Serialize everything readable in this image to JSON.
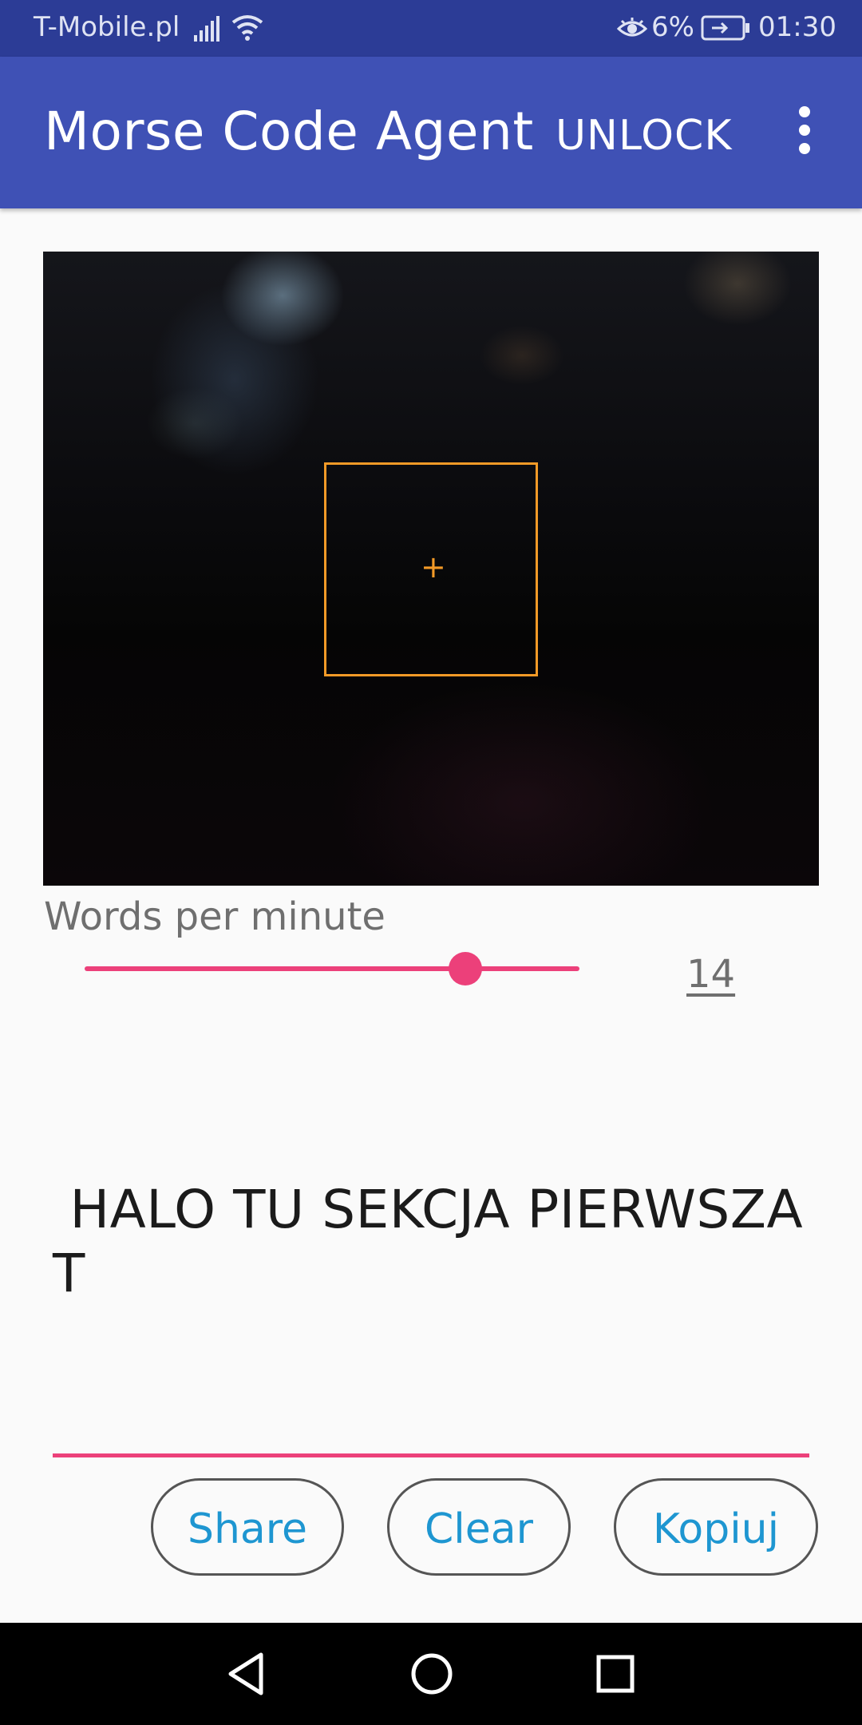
{
  "status_bar": {
    "carrier": "T-Mobile.pl",
    "signal_icon": "signal-bars-icon",
    "wifi_icon": "wifi-icon",
    "eye_icon": "eye-comfort-icon",
    "battery_percent": "6%",
    "battery_icon": "battery-charging-icon",
    "time": "01:30"
  },
  "app_bar": {
    "title": "Morse Code Agent",
    "unlock_label": "UNLOCK",
    "overflow_icon": "more-vert-icon"
  },
  "camera": {
    "focus_marker": "+",
    "focus_color": "#f39a27"
  },
  "wpm": {
    "label": "Words per minute",
    "value": "14",
    "slider_fraction": 0.77
  },
  "decoded": {
    "text": " HALO TU SEKCJA PIERWSZA T"
  },
  "buttons": {
    "share": "Share",
    "clear": "Clear",
    "copy": "Kopiuj"
  },
  "nav": {
    "back_icon": "nav-back-icon",
    "home_icon": "nav-home-icon",
    "recent_icon": "nav-recent-icon"
  },
  "colors": {
    "status_bar": "#2c3c96",
    "app_bar": "#3f51b5",
    "accent": "#ec407a",
    "button_text": "#1e96d1"
  }
}
